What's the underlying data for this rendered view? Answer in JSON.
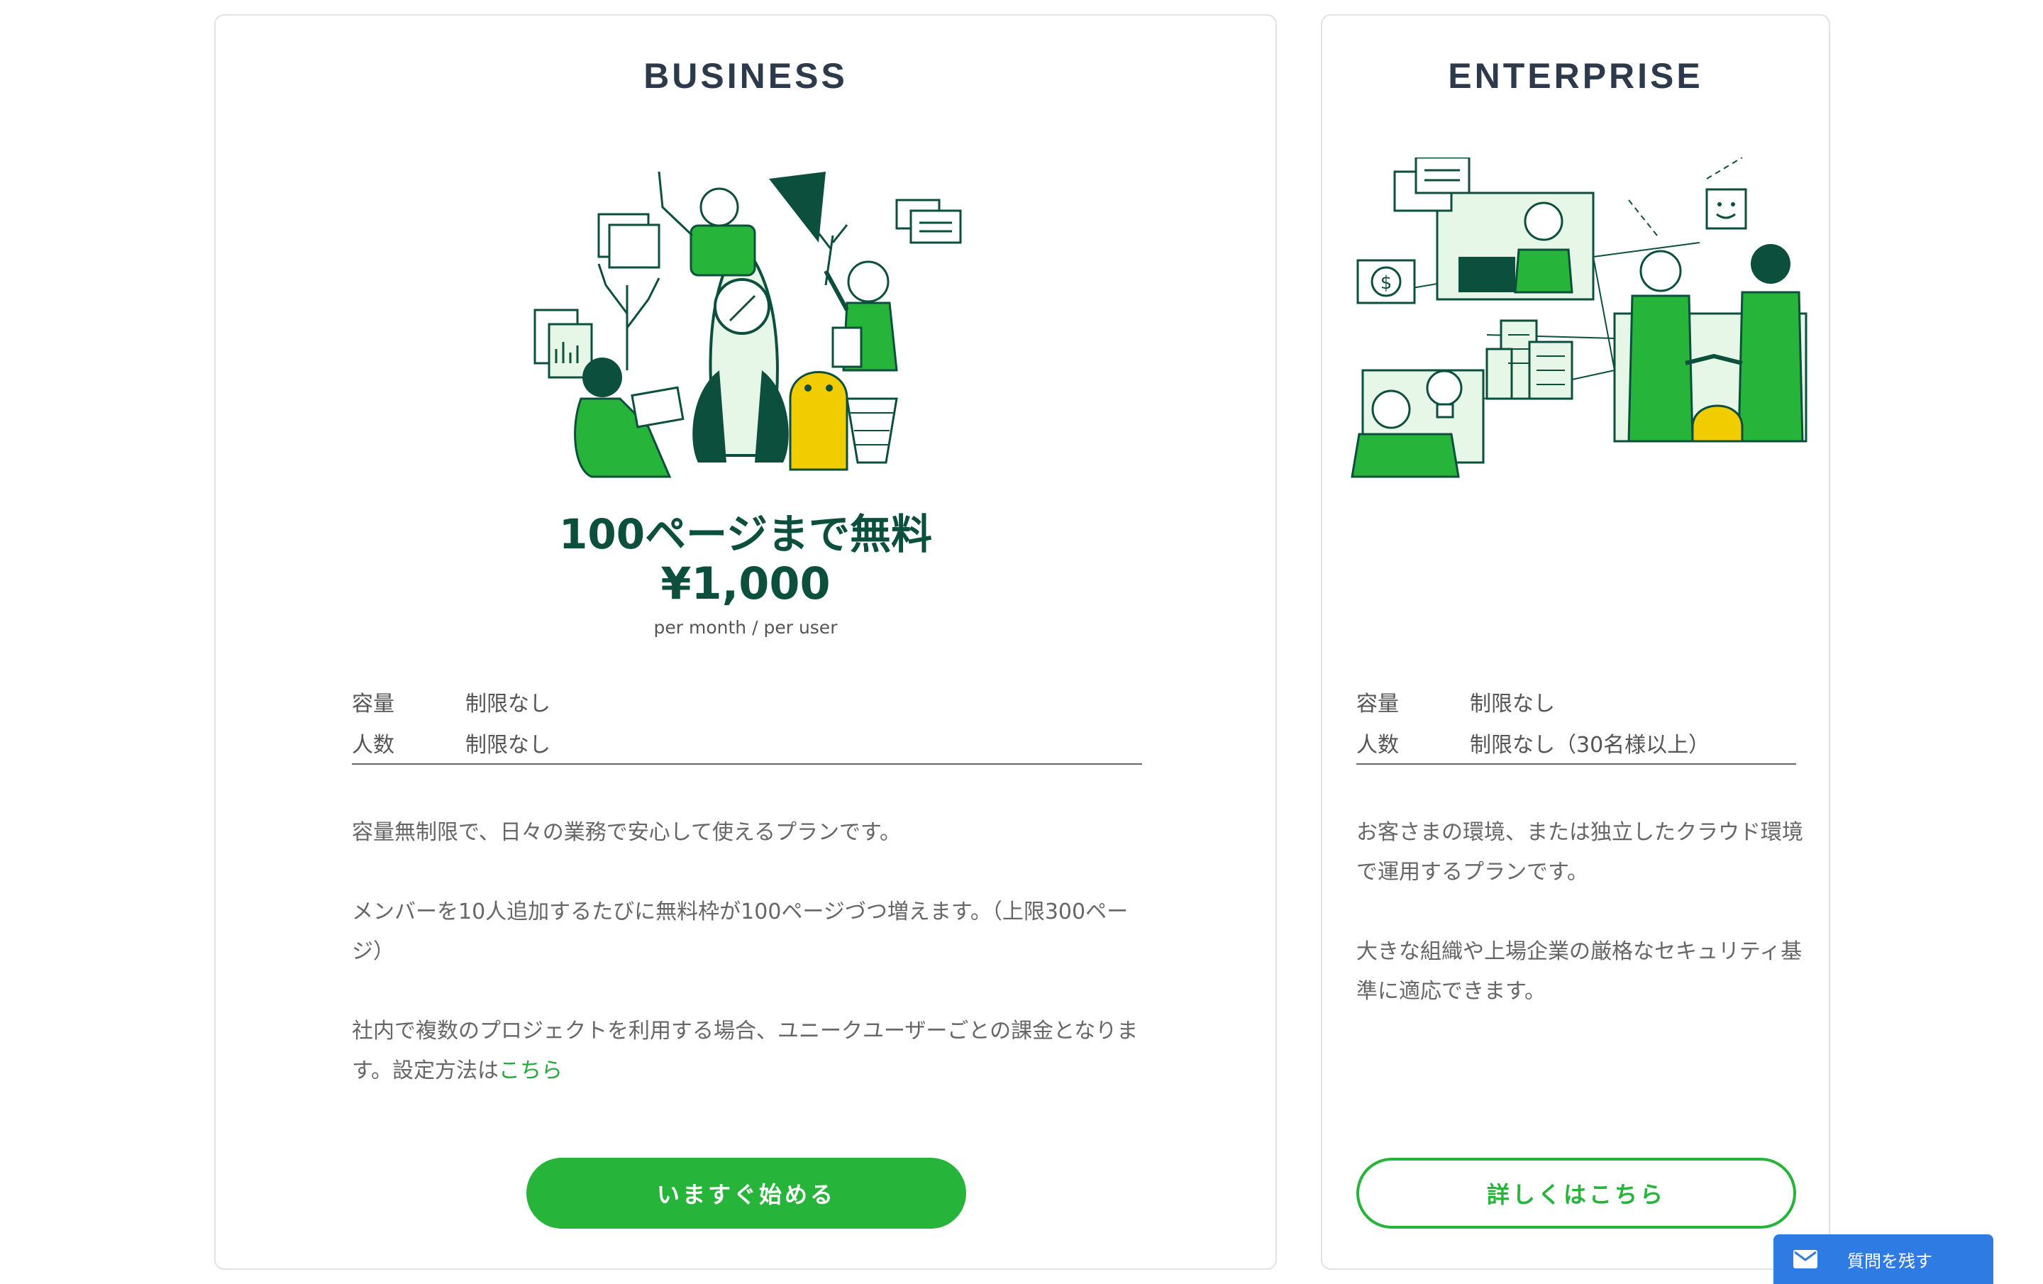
{
  "colors": {
    "accent_green": "#27b43a",
    "dark_green": "#0c4f3c",
    "title_navy": "#2c3a4b",
    "feedback_blue": "#2f7be4"
  },
  "business": {
    "name": "BUSINESS",
    "illustration": "team-rocket-illustration",
    "free_text": "100ページまで無料",
    "price": "¥1,000",
    "price_unit": "per month / per user",
    "specs": [
      {
        "key": "容量",
        "value": "制限なし"
      },
      {
        "key": "人数",
        "value": "制限なし"
      }
    ],
    "desc1": "容量無制限で、日々の業務で安心して使えるプランです。",
    "desc2": "メンバーを10人追加するたびに無料枠が100ページづつ増えます。（上限300ページ）",
    "desc3_prefix": "社内で複数のプロジェクトを利用する場合、ユニークユーザーごとの課金となります。設定方法は",
    "desc3_link": "こちら",
    "cta": "いますぐ始める"
  },
  "enterprise": {
    "name": "ENTERPRISE",
    "illustration": "business-network-illustration",
    "specs": [
      {
        "key": "容量",
        "value": "制限なし"
      },
      {
        "key": "人数",
        "value": "制限なし（30名様以上）"
      }
    ],
    "desc1": "お客さまの環境、または独立したクラウド環境で運用するプランです。",
    "desc2": "大きな組織や上場企業の厳格なセキュリティ基準に適応できます。",
    "cta": "詳しくはこちら"
  },
  "feedback": {
    "icon": "mail-icon",
    "label": "質問を残す"
  }
}
